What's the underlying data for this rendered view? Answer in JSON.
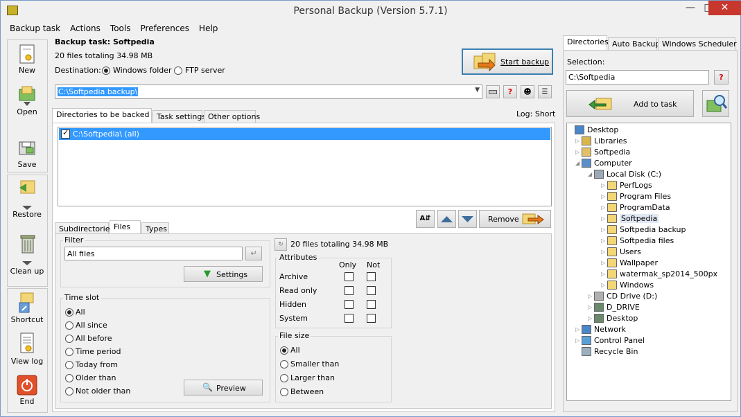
{
  "window": {
    "title": "Personal Backup (Version 5.7.1)"
  },
  "menu": [
    "Backup task",
    "Actions",
    "Tools",
    "Preferences",
    "Help"
  ],
  "toolbar": [
    {
      "label": "New",
      "icon": "new-task-icon"
    },
    {
      "label": "Open",
      "icon": "open-task-icon"
    },
    {
      "label": "Save",
      "icon": "save-task-icon"
    },
    {
      "label": "Restore",
      "icon": "restore-icon"
    },
    {
      "label": "Clean up",
      "icon": "cleanup-trash-icon"
    },
    {
      "label": "Shortcut",
      "icon": "shortcut-icon"
    },
    {
      "label": "View log",
      "icon": "view-log-icon"
    },
    {
      "label": "End",
      "icon": "power-icon"
    }
  ],
  "task": {
    "title": "Backup task: Softpedia",
    "summary": "20 files totaling 34.98 MB",
    "destination_label": "Destination:",
    "dest_windows": "Windows folder",
    "dest_ftp": "FTP server",
    "path": "C:\\Softpedia backup\\",
    "start_label": "Start backup",
    "log_label": "Log: Short"
  },
  "main_tabs": [
    "Directories to be backed up",
    "Task settings",
    "Other options"
  ],
  "dir_list": [
    {
      "text": "C:\\Softpedia\\ (all)",
      "checked": true
    }
  ],
  "remove_label": "Remove",
  "sub_tabs": [
    "Subdirectories",
    "Files",
    "Types"
  ],
  "filter": {
    "title": "Filter",
    "value": "All files",
    "settings_label": "Settings"
  },
  "timeslot": {
    "title": "Time slot",
    "options": [
      "All",
      "All since",
      "All before",
      "Time period",
      "Today from",
      "Older than",
      "Not older than"
    ],
    "selected": 0
  },
  "preview_label": "Preview",
  "files_summary": "20 files totaling 34.98 MB",
  "attributes": {
    "title": "Attributes",
    "col_only": "Only",
    "col_not": "Not",
    "rows": [
      "Archive",
      "Read only",
      "Hidden",
      "System"
    ]
  },
  "filesize": {
    "title": "File size",
    "options": [
      "All",
      "Smaller than",
      "Larger than",
      "Between"
    ],
    "selected": 0
  },
  "right_tabs": [
    "Directories",
    "Auto Backup",
    "Windows Scheduler"
  ],
  "selection": {
    "label": "Selection:",
    "value": "C:\\Softpedia",
    "add_label": "Add to task"
  },
  "tree": [
    {
      "label": "Desktop",
      "level": 0,
      "icon": "desktop-icon",
      "exp": ""
    },
    {
      "label": "Libraries",
      "level": 1,
      "icon": "libraries-icon",
      "exp": "closed"
    },
    {
      "label": "Softpedia",
      "level": 1,
      "icon": "user-folder-icon",
      "exp": "closed"
    },
    {
      "label": "Computer",
      "level": 1,
      "icon": "computer-icon",
      "exp": "open"
    },
    {
      "label": "Local Disk (C:)",
      "level": 2,
      "icon": "hard-disk-icon",
      "exp": "open"
    },
    {
      "label": "PerfLogs",
      "level": 3,
      "icon": "folder-icon",
      "exp": "closed"
    },
    {
      "label": "Program Files",
      "level": 3,
      "icon": "folder-icon",
      "exp": "closed"
    },
    {
      "label": "ProgramData",
      "level": 3,
      "icon": "folder-icon",
      "exp": "closed"
    },
    {
      "label": "Softpedia",
      "level": 3,
      "icon": "folder-icon",
      "exp": "closed",
      "selected": true
    },
    {
      "label": "Softpedia backup",
      "level": 3,
      "icon": "folder-icon",
      "exp": "closed"
    },
    {
      "label": "Softpedia files",
      "level": 3,
      "icon": "folder-icon",
      "exp": "closed"
    },
    {
      "label": "Users",
      "level": 3,
      "icon": "folder-icon",
      "exp": "closed"
    },
    {
      "label": "Wallpaper",
      "level": 3,
      "icon": "folder-icon",
      "exp": "closed"
    },
    {
      "label": "watermak_sp2014_500px",
      "level": 3,
      "icon": "folder-icon",
      "exp": "closed"
    },
    {
      "label": "Windows",
      "level": 3,
      "icon": "folder-icon",
      "exp": "closed"
    },
    {
      "label": "CD Drive (D:)",
      "level": 2,
      "icon": "cd-drive-icon",
      "exp": "closed"
    },
    {
      "label": "D_DRIVE",
      "level": 2,
      "icon": "network-drive-icon",
      "exp": "closed"
    },
    {
      "label": "Desktop",
      "level": 2,
      "icon": "network-drive-icon",
      "exp": "closed"
    },
    {
      "label": "Network",
      "level": 1,
      "icon": "network-icon",
      "exp": "closed"
    },
    {
      "label": "Control Panel",
      "level": 1,
      "icon": "control-panel-icon",
      "exp": "closed"
    },
    {
      "label": "Recycle Bin",
      "level": 1,
      "icon": "recycle-bin-icon",
      "exp": ""
    }
  ]
}
